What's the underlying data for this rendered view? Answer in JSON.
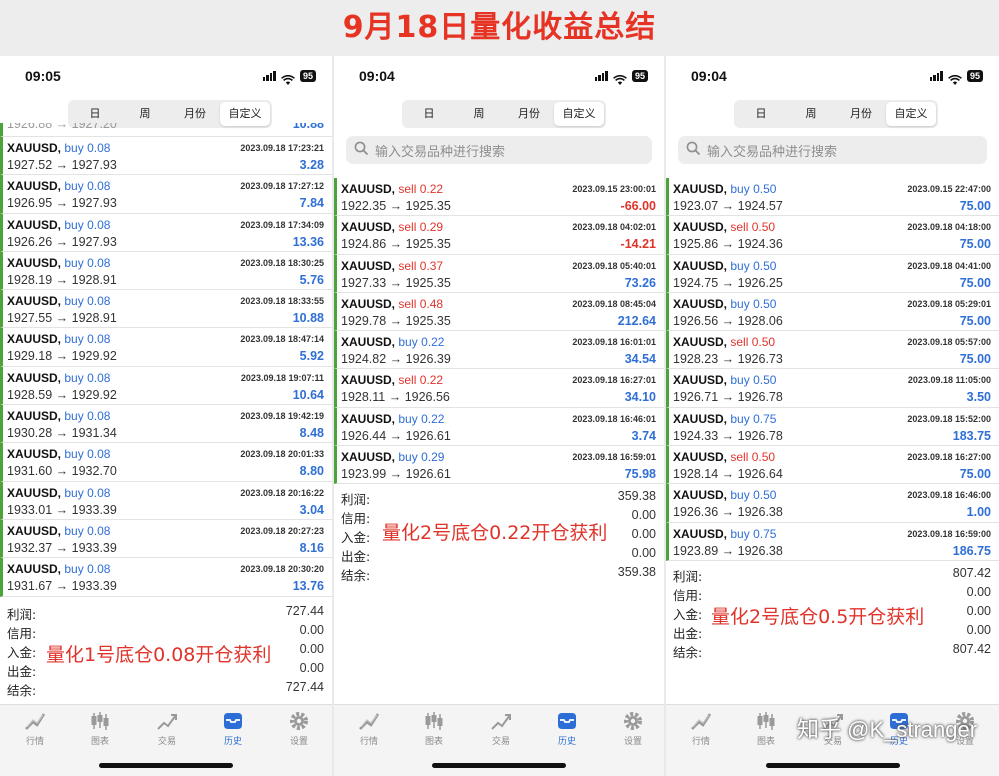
{
  "title": "9月18日量化收益总结",
  "watermark": "知乎 @K_stranger",
  "tabs": [
    "日",
    "周",
    "月份",
    "自定义"
  ],
  "bottom_nav": [
    {
      "label": "行情",
      "icon": "quotes-icon"
    },
    {
      "label": "图表",
      "icon": "candlestick-chart-icon"
    },
    {
      "label": "交易",
      "icon": "trade-icon"
    },
    {
      "label": "历史",
      "icon": "history-icon"
    },
    {
      "label": "设置",
      "icon": "settings-icon"
    }
  ],
  "colors": {
    "title": "#e63323",
    "buy": "#2f6fd6",
    "sell": "#e0342b",
    "profit": "#2f6fd6",
    "loss": "#e0342b",
    "accent_bar": "#4da33b",
    "active_tab": "#2d6ed6"
  },
  "panels": [
    {
      "time": "09:05",
      "battery": "95",
      "search_placeholder": "",
      "partial_top": {
        "prices": "1926.88 → 1927.20",
        "profit": "10.88"
      },
      "trades": [
        {
          "symbol": "XAUUSD,",
          "side": "buy",
          "lots": "0.08",
          "datetime": "2023.09.18 17:23:21",
          "prices": "1927.52 → 1927.93",
          "profit": "3.28"
        },
        {
          "symbol": "XAUUSD,",
          "side": "buy",
          "lots": "0.08",
          "datetime": "2023.09.18 17:27:12",
          "prices": "1926.95 → 1927.93",
          "profit": "7.84"
        },
        {
          "symbol": "XAUUSD,",
          "side": "buy",
          "lots": "0.08",
          "datetime": "2023.09.18 17:34:09",
          "prices": "1926.26 → 1927.93",
          "profit": "13.36"
        },
        {
          "symbol": "XAUUSD,",
          "side": "buy",
          "lots": "0.08",
          "datetime": "2023.09.18 18:30:25",
          "prices": "1928.19 → 1928.91",
          "profit": "5.76"
        },
        {
          "symbol": "XAUUSD,",
          "side": "buy",
          "lots": "0.08",
          "datetime": "2023.09.18 18:33:55",
          "prices": "1927.55 → 1928.91",
          "profit": "10.88"
        },
        {
          "symbol": "XAUUSD,",
          "side": "buy",
          "lots": "0.08",
          "datetime": "2023.09.18 18:47:14",
          "prices": "1929.18 → 1929.92",
          "profit": "5.92"
        },
        {
          "symbol": "XAUUSD,",
          "side": "buy",
          "lots": "0.08",
          "datetime": "2023.09.18 19:07:11",
          "prices": "1928.59 → 1929.92",
          "profit": "10.64"
        },
        {
          "symbol": "XAUUSD,",
          "side": "buy",
          "lots": "0.08",
          "datetime": "2023.09.18 19:42:19",
          "prices": "1930.28 → 1931.34",
          "profit": "8.48"
        },
        {
          "symbol": "XAUUSD,",
          "side": "buy",
          "lots": "0.08",
          "datetime": "2023.09.18 20:01:33",
          "prices": "1931.60 → 1932.70",
          "profit": "8.80"
        },
        {
          "symbol": "XAUUSD,",
          "side": "buy",
          "lots": "0.08",
          "datetime": "2023.09.18 20:16:22",
          "prices": "1933.01 → 1933.39",
          "profit": "3.04"
        },
        {
          "symbol": "XAUUSD,",
          "side": "buy",
          "lots": "0.08",
          "datetime": "2023.09.18 20:27:23",
          "prices": "1932.37 → 1933.39",
          "profit": "8.16"
        },
        {
          "symbol": "XAUUSD,",
          "side": "buy",
          "lots": "0.08",
          "datetime": "2023.09.18 20:30:20",
          "prices": "1931.67 → 1933.39",
          "profit": "13.76"
        }
      ],
      "summary": [
        {
          "label": "利润:",
          "value": "727.44"
        },
        {
          "label": "信用:",
          "value": "0.00"
        },
        {
          "label": "入金:",
          "value": "0.00"
        },
        {
          "label": "出金:",
          "value": "0.00"
        },
        {
          "label": "结余:",
          "value": "727.44"
        }
      ],
      "overlay": "量化1号底仓0.08开仓获利"
    },
    {
      "time": "09:04",
      "battery": "95",
      "search_placeholder": "输入交易品种进行搜索",
      "trades": [
        {
          "symbol": "XAUUSD,",
          "side": "sell",
          "lots": "0.22",
          "datetime": "2023.09.15 23:00:01",
          "prices": "1922.35 → 1925.35",
          "profit": "-66.00"
        },
        {
          "symbol": "XAUUSD,",
          "side": "sell",
          "lots": "0.29",
          "datetime": "2023.09.18 04:02:01",
          "prices": "1924.86 → 1925.35",
          "profit": "-14.21"
        },
        {
          "symbol": "XAUUSD,",
          "side": "sell",
          "lots": "0.37",
          "datetime": "2023.09.18 05:40:01",
          "prices": "1927.33 → 1925.35",
          "profit": "73.26"
        },
        {
          "symbol": "XAUUSD,",
          "side": "sell",
          "lots": "0.48",
          "datetime": "2023.09.18 08:45:04",
          "prices": "1929.78 → 1925.35",
          "profit": "212.64"
        },
        {
          "symbol": "XAUUSD,",
          "side": "buy",
          "lots": "0.22",
          "datetime": "2023.09.18 16:01:01",
          "prices": "1924.82 → 1926.39",
          "profit": "34.54"
        },
        {
          "symbol": "XAUUSD,",
          "side": "sell",
          "lots": "0.22",
          "datetime": "2023.09.18 16:27:01",
          "prices": "1928.11 → 1926.56",
          "profit": "34.10"
        },
        {
          "symbol": "XAUUSD,",
          "side": "buy",
          "lots": "0.22",
          "datetime": "2023.09.18 16:46:01",
          "prices": "1926.44 → 1926.61",
          "profit": "3.74"
        },
        {
          "symbol": "XAUUSD,",
          "side": "buy",
          "lots": "0.29",
          "datetime": "2023.09.18 16:59:01",
          "prices": "1923.99 → 1926.61",
          "profit": "75.98"
        }
      ],
      "summary": [
        {
          "label": "利润:",
          "value": "359.38"
        },
        {
          "label": "信用:",
          "value": "0.00"
        },
        {
          "label": "入金:",
          "value": "0.00"
        },
        {
          "label": "出金:",
          "value": "0.00"
        },
        {
          "label": "结余:",
          "value": "359.38"
        }
      ],
      "overlay": "量化2号底仓0.22开仓获利"
    },
    {
      "time": "09:04",
      "battery": "95",
      "search_placeholder": "输入交易品种进行搜索",
      "trades": [
        {
          "symbol": "XAUUSD,",
          "side": "buy",
          "lots": "0.50",
          "datetime": "2023.09.15 22:47:00",
          "prices": "1923.07 → 1924.57",
          "profit": "75.00"
        },
        {
          "symbol": "XAUUSD,",
          "side": "sell",
          "lots": "0.50",
          "datetime": "2023.09.18 04:18:00",
          "prices": "1925.86 → 1924.36",
          "profit": "75.00"
        },
        {
          "symbol": "XAUUSD,",
          "side": "buy",
          "lots": "0.50",
          "datetime": "2023.09.18 04:41:00",
          "prices": "1924.75 → 1926.25",
          "profit": "75.00"
        },
        {
          "symbol": "XAUUSD,",
          "side": "buy",
          "lots": "0.50",
          "datetime": "2023.09.18 05:29:01",
          "prices": "1926.56 → 1928.06",
          "profit": "75.00"
        },
        {
          "symbol": "XAUUSD,",
          "side": "sell",
          "lots": "0.50",
          "datetime": "2023.09.18 05:57:00",
          "prices": "1928.23 → 1926.73",
          "profit": "75.00"
        },
        {
          "symbol": "XAUUSD,",
          "side": "buy",
          "lots": "0.50",
          "datetime": "2023.09.18 11:05:00",
          "prices": "1926.71 → 1926.78",
          "profit": "3.50"
        },
        {
          "symbol": "XAUUSD,",
          "side": "buy",
          "lots": "0.75",
          "datetime": "2023.09.18 15:52:00",
          "prices": "1924.33 → 1926.78",
          "profit": "183.75"
        },
        {
          "symbol": "XAUUSD,",
          "side": "sell",
          "lots": "0.50",
          "datetime": "2023.09.18 16:27:00",
          "prices": "1928.14 → 1926.64",
          "profit": "75.00"
        },
        {
          "symbol": "XAUUSD,",
          "side": "buy",
          "lots": "0.50",
          "datetime": "2023.09.18 16:46:00",
          "prices": "1926.36 → 1926.38",
          "profit": "1.00"
        },
        {
          "symbol": "XAUUSD,",
          "side": "buy",
          "lots": "0.75",
          "datetime": "2023.09.18 16:59:00",
          "prices": "1923.89 → 1926.38",
          "profit": "186.75"
        }
      ],
      "summary": [
        {
          "label": "利润:",
          "value": "807.42"
        },
        {
          "label": "信用:",
          "value": "0.00"
        },
        {
          "label": "入金:",
          "value": "0.00"
        },
        {
          "label": "出金:",
          "value": "0.00"
        },
        {
          "label": "结余:",
          "value": "807.42"
        }
      ],
      "overlay": "量化2号底仓0.5开仓获利"
    }
  ]
}
